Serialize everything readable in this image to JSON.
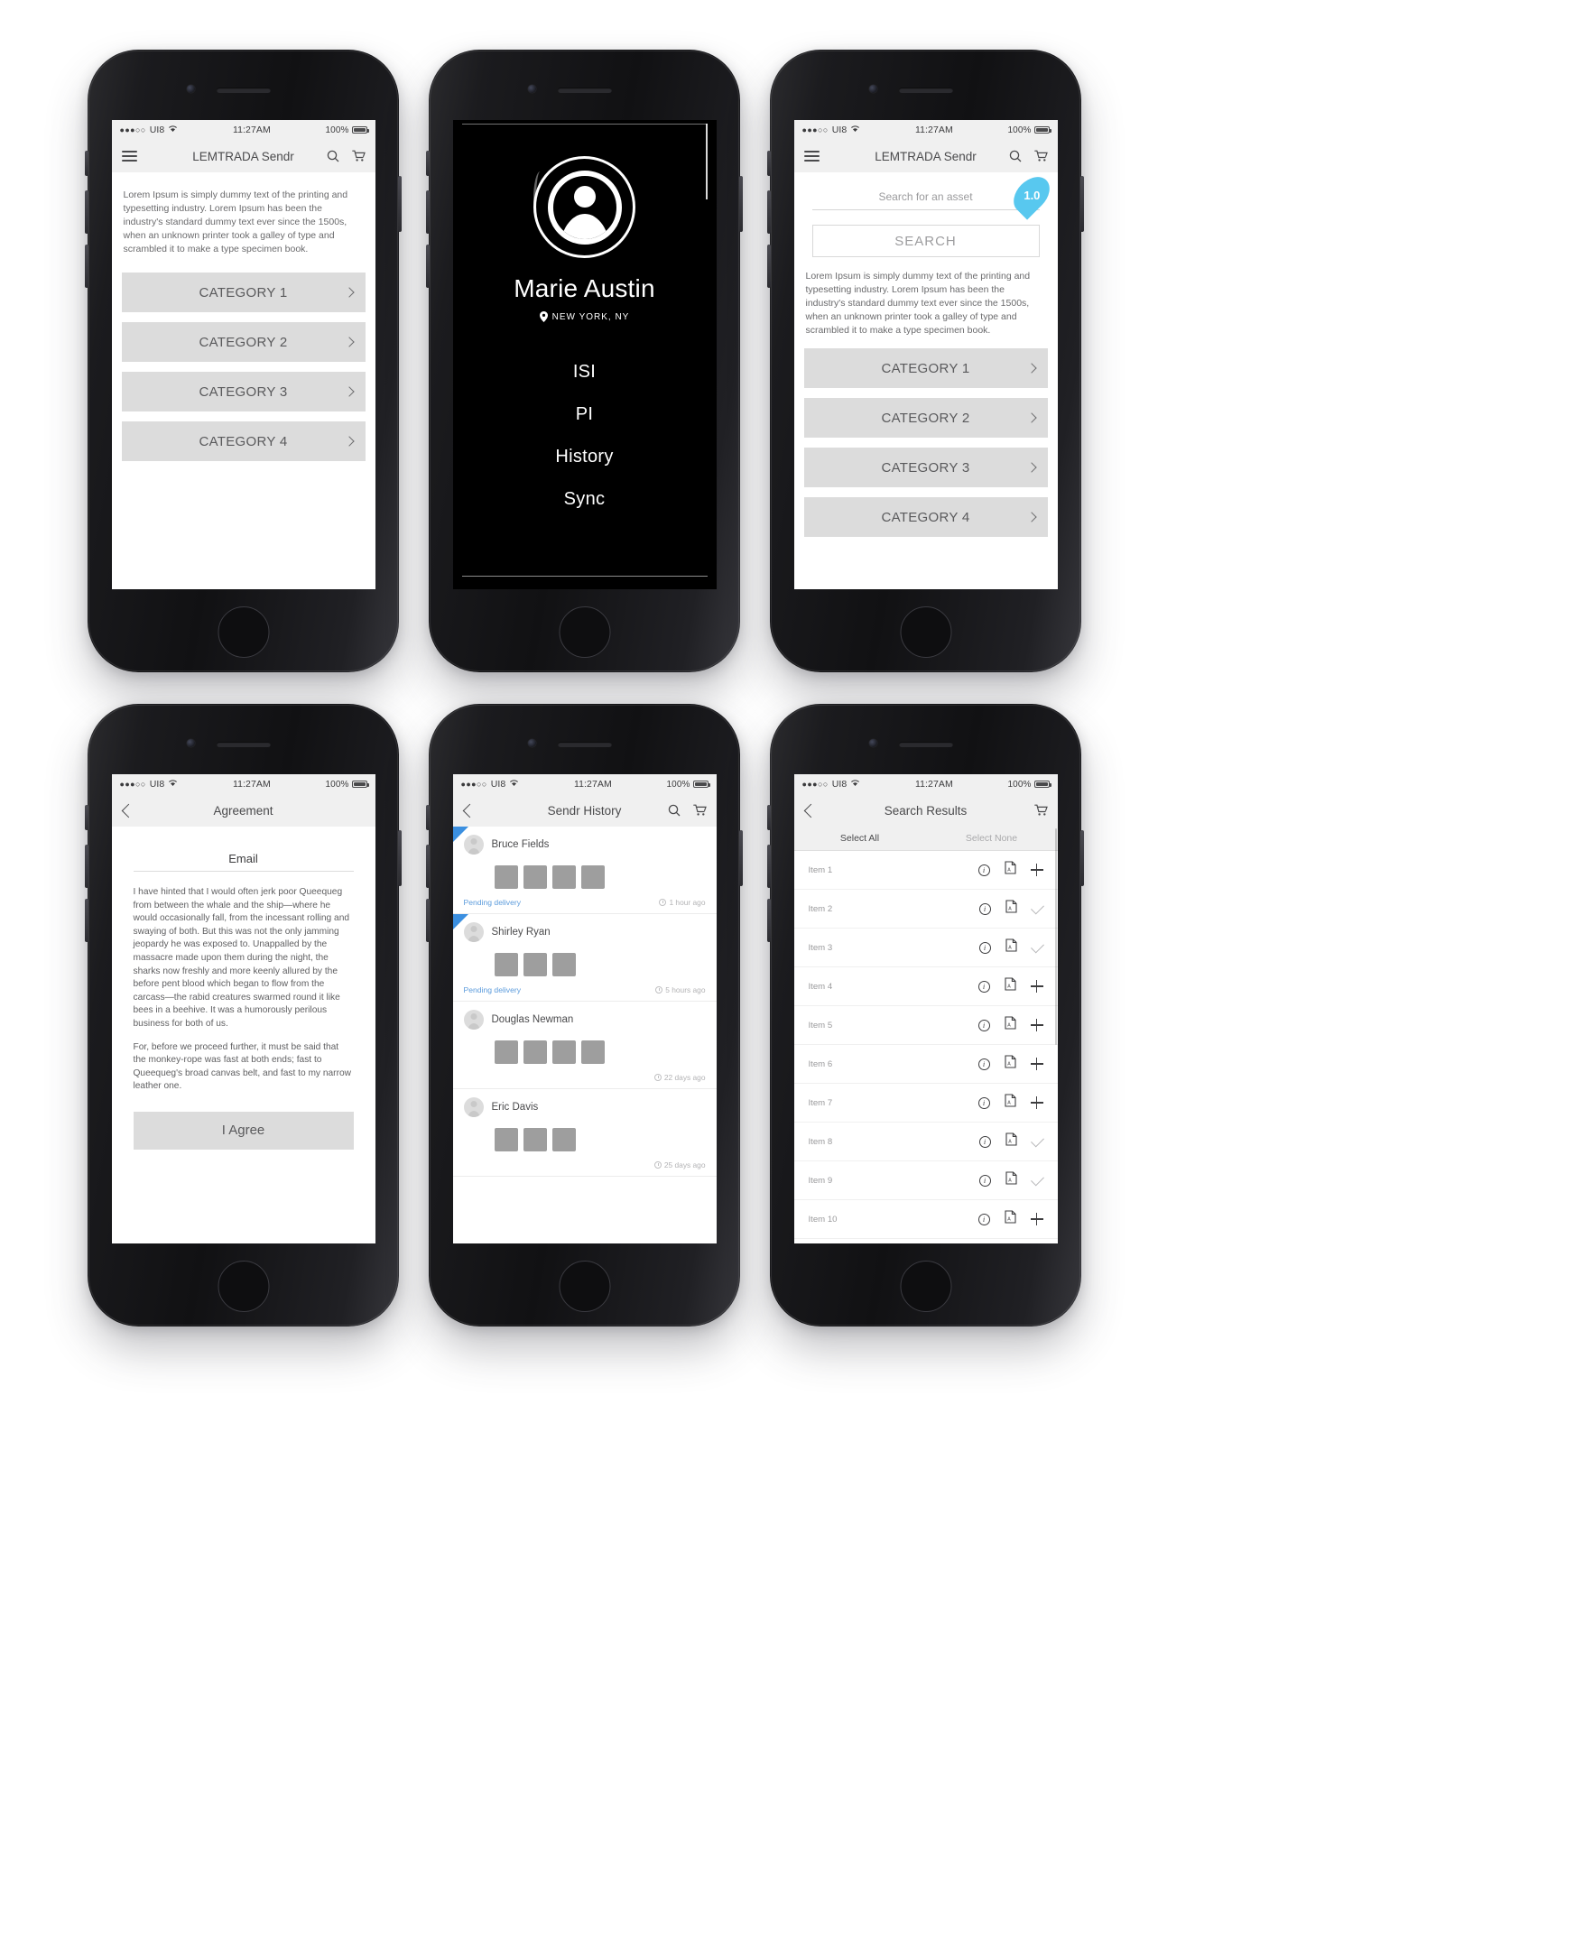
{
  "status_bar": {
    "signal_dots": "●●●○○",
    "carrier": "UI8",
    "wifi_icon": "wifi-icon",
    "time": "11:27AM",
    "battery_percent": "100%"
  },
  "colors": {
    "accent_blue": "#3b8fe0",
    "badge_cyan": "#58c8ef",
    "pending_blue": "#5b9bdc",
    "button_gray": "#dcdcdc",
    "bar_gray": "#f0f0f0"
  },
  "screens": {
    "categories": {
      "nav": {
        "menu_icon": "hamburger-icon",
        "title": "LEMTRADA Sendr",
        "search_icon": "search-icon",
        "cart_icon": "cart-icon"
      },
      "body_text": "Lorem Ipsum is simply dummy text of the printing and typesetting industry. Lorem Ipsum has been the industry's standard dummy text ever since the 1500s, when an unknown printer took a galley of type and scrambled it to make a type specimen book.",
      "categories": [
        "CATEGORY 1",
        "CATEGORY 2",
        "CATEGORY 3",
        "CATEGORY 4"
      ]
    },
    "profile": {
      "avatar_icon": "user-avatar-icon",
      "name": "Marie Austin",
      "location_icon": "location-pin-icon",
      "location": "NEW YORK, NY",
      "menu": [
        "ISI",
        "PI",
        "History",
        "Sync"
      ]
    },
    "search": {
      "nav": {
        "menu_icon": "hamburger-icon",
        "title": "LEMTRADA Sendr",
        "search_icon": "search-icon",
        "cart_icon": "cart-icon"
      },
      "search_placeholder": "Search for an asset",
      "version_badge": "1.0",
      "search_button": "SEARCH",
      "body_text": "Lorem Ipsum is simply dummy text of the printing and typesetting industry. Lorem Ipsum has been the industry's standard dummy text ever since the 1500s, when an unknown printer took a galley of type and scrambled it to make a type specimen book.",
      "categories": [
        "CATEGORY 1",
        "CATEGORY 2",
        "CATEGORY 3",
        "CATEGORY 4"
      ]
    },
    "agreement": {
      "nav": {
        "back_icon": "chevron-left-icon",
        "title": "Agreement"
      },
      "field_label": "Email",
      "paragraphs": [
        "I have hinted that I would often jerk poor Queequeg from between the whale and the ship—where he would occasionally fall, from the incessant rolling and swaying of both. But this was not the only jamming jeopardy he was exposed to. Unappalled by the massacre made upon them during the night, the sharks now freshly and more keenly allured by the before pent blood which began to flow from the carcass—the rabid creatures swarmed round it like bees in a beehive. It was a humorously perilous business for both of us.",
        "For, before we proceed further, it must be said that the monkey-rope was fast at both ends; fast to Queequeg's broad canvas belt, and fast to my narrow leather one."
      ],
      "agree_button": "I Agree"
    },
    "history": {
      "nav": {
        "back_icon": "chevron-left-icon",
        "title": "Sendr History",
        "search_icon": "search-icon",
        "cart_icon": "cart-icon"
      },
      "items": [
        {
          "name": "Bruce Fields",
          "thumbs": 4,
          "status": "Pending delivery",
          "time": "1 hour ago",
          "flagged": true
        },
        {
          "name": "Shirley Ryan",
          "thumbs": 3,
          "status": "Pending delivery",
          "time": "5 hours ago",
          "flagged": true
        },
        {
          "name": "Douglas Newman",
          "thumbs": 4,
          "status": "",
          "time": "22 days ago",
          "flagged": false
        },
        {
          "name": "Eric Davis",
          "thumbs": 3,
          "status": "",
          "time": "25 days ago",
          "flagged": false
        }
      ]
    },
    "search_results": {
      "nav": {
        "back_icon": "chevron-left-icon",
        "title": "Search Results",
        "cart_icon": "cart-icon"
      },
      "select_all": "Select All",
      "select_none": "Select None",
      "rows": [
        {
          "label": "Item 1",
          "info_icon": "info-icon",
          "file_icon": "pdf-file-icon",
          "action": "plus"
        },
        {
          "label": "Item 2",
          "info_icon": "info-icon",
          "file_icon": "pdf-file-icon",
          "action": "check"
        },
        {
          "label": "Item 3",
          "info_icon": "info-icon",
          "file_icon": "pdf-file-icon",
          "action": "check"
        },
        {
          "label": "Item 4",
          "info_icon": "info-icon",
          "file_icon": "pdf-file-icon",
          "action": "plus"
        },
        {
          "label": "Item 5",
          "info_icon": "info-icon",
          "file_icon": "pdf-file-icon",
          "action": "plus"
        },
        {
          "label": "Item 6",
          "info_icon": "info-icon",
          "file_icon": "pdf-file-icon",
          "action": "plus"
        },
        {
          "label": "Item 7",
          "info_icon": "info-icon",
          "file_icon": "pdf-file-icon",
          "action": "plus"
        },
        {
          "label": "Item 8",
          "info_icon": "info-icon",
          "file_icon": "pdf-file-icon",
          "action": "check"
        },
        {
          "label": "Item 9",
          "info_icon": "info-icon",
          "file_icon": "pdf-file-icon",
          "action": "check"
        },
        {
          "label": "Item 10",
          "info_icon": "info-icon",
          "file_icon": "pdf-file-icon",
          "action": "plus"
        }
      ]
    }
  }
}
